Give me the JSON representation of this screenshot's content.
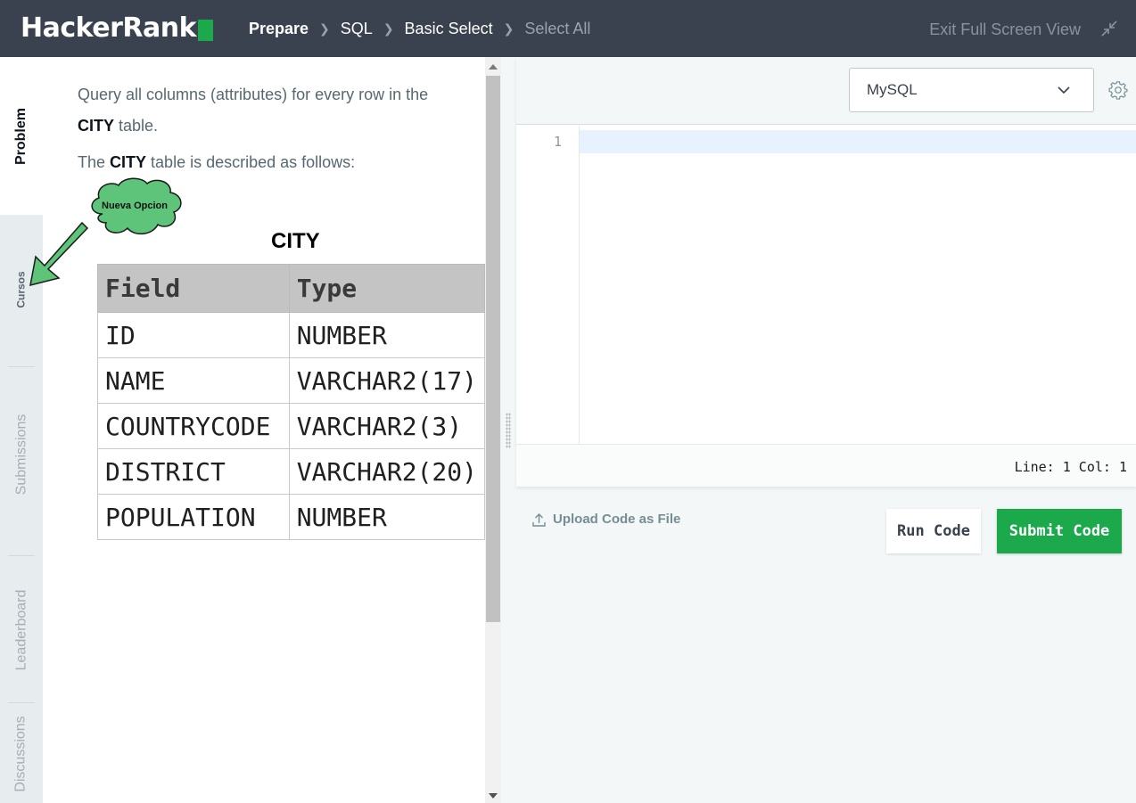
{
  "header": {
    "logo_text": "HackerRank",
    "breadcrumbs": [
      "Prepare",
      "SQL",
      "Basic Select",
      "Select All"
    ],
    "exit_label": "Exit Full Screen View"
  },
  "tabs": {
    "problem": "Problem",
    "cursos": "Cursos",
    "submissions": "Submissions",
    "leaderboard": "Leaderboard",
    "discussions": "Discussions"
  },
  "problem": {
    "line1": "Query all columns (attributes) for every row in the",
    "line2_bold": "CITY",
    "line2_rest": " table.",
    "line3_pre": "The ",
    "line3_bold": "CITY",
    "line3_rest": " table is described as follows:",
    "table_title": "CITY",
    "table_headers": [
      "Field",
      "Type"
    ],
    "table_rows": [
      [
        "ID",
        "NUMBER"
      ],
      [
        "NAME",
        "VARCHAR2(17)"
      ],
      [
        "COUNTRYCODE",
        "VARCHAR2(3)"
      ],
      [
        "DISTRICT",
        "VARCHAR2(20)"
      ],
      [
        "POPULATION",
        "NUMBER"
      ]
    ]
  },
  "annotation": {
    "cloud_text": "Nueva Opcion",
    "cloud_color": "#5ec47a",
    "arrow_color": "#5ec47a"
  },
  "editor": {
    "language": "MySQL",
    "line_number": "1",
    "status": "Line: 1 Col: 1"
  },
  "actions": {
    "upload_label": "Upload Code as File",
    "run_label": "Run Code",
    "submit_label": "Submit Code"
  },
  "colors": {
    "header_bg": "#39424e",
    "accent_green": "#1ba94c"
  }
}
